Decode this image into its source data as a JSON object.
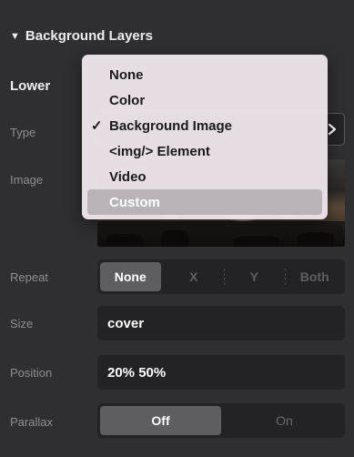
{
  "section": {
    "title": "Background Layers",
    "collapse_icon": "triangle-down-icon"
  },
  "layer": {
    "title": "Lower"
  },
  "labels": {
    "type": "Type",
    "image": "Image",
    "repeat": "Repeat",
    "size": "Size",
    "position": "Position",
    "parallax": "Parallax"
  },
  "type_dropdown": {
    "selected": "Background Image",
    "highlighted": "Custom",
    "options": [
      "None",
      "Color",
      "Background Image",
      "<img/> Element",
      "Video",
      "Custom"
    ]
  },
  "repeat": {
    "options": [
      "None",
      "X",
      "Y",
      "Both"
    ],
    "selected": "None"
  },
  "size": {
    "value": "cover"
  },
  "position": {
    "value": "20% 50%"
  },
  "parallax": {
    "options": [
      "Off",
      "On"
    ],
    "selected": "Off"
  }
}
